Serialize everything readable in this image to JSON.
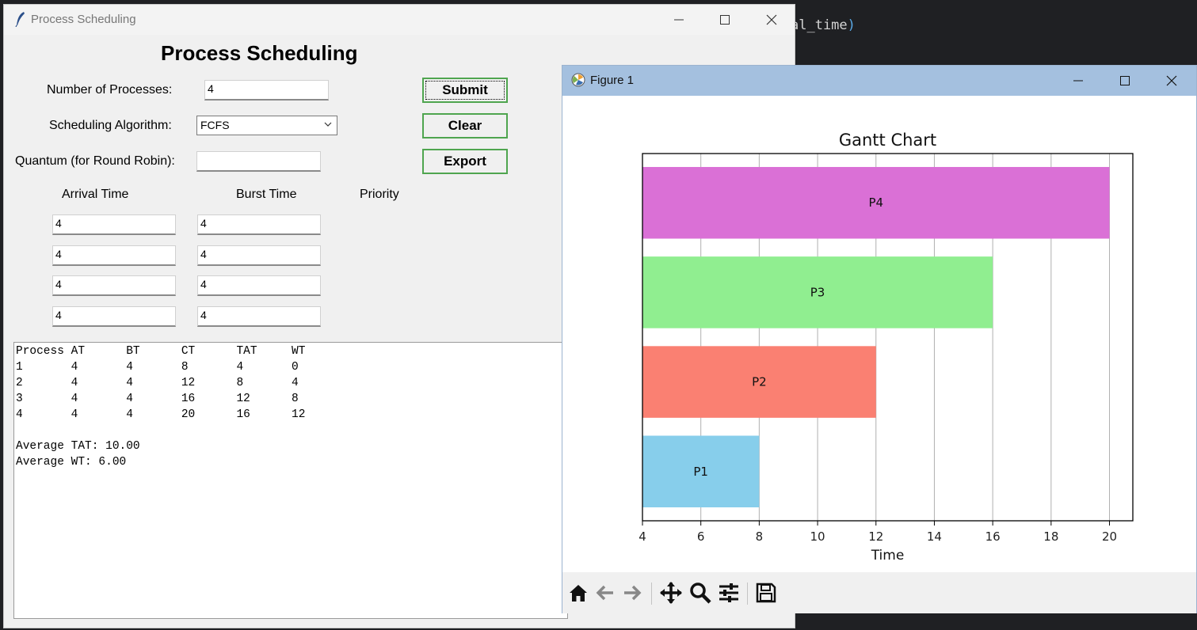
{
  "editor": {
    "code_fragment": "al_time",
    "code_paren": ")"
  },
  "tk_window": {
    "title": "Process Scheduling",
    "heading": "Process Scheduling",
    "labels": {
      "num_processes": "Number of Processes:",
      "algorithm": "Scheduling Algorithm:",
      "quantum": "Quantum (for Round Robin):",
      "arrival_time": "Arrival Time",
      "burst_time": "Burst Time",
      "priority": "Priority"
    },
    "num_processes_value": "4",
    "algorithm_value": "FCFS",
    "quantum_value": "",
    "buttons": {
      "submit": "Submit",
      "clear": "Clear",
      "export": "Export"
    },
    "process_rows": [
      {
        "arrival": "4",
        "burst": "4"
      },
      {
        "arrival": "4",
        "burst": "4"
      },
      {
        "arrival": "4",
        "burst": "4"
      },
      {
        "arrival": "4",
        "burst": "4"
      }
    ],
    "output_text": "Process AT      BT      CT      TAT     WT\n1       4       4       8       4       0\n2       4       4       12      8       4\n3       4       4       16      12      8\n4       4       4       20      16      12\n\nAverage TAT: 10.00\nAverage WT: 6.00"
  },
  "figure_window": {
    "title": "Figure 1",
    "toolbar": [
      "home-icon",
      "back-icon",
      "forward-icon",
      "pan-icon",
      "zoom-icon",
      "configure-icon",
      "save-icon"
    ]
  },
  "chart_data": {
    "type": "bar",
    "orientation": "horizontal",
    "title": "Gantt Chart",
    "xlabel": "Time",
    "ylabel": "",
    "xlim": [
      4,
      20.8
    ],
    "xticks": [
      4,
      6,
      8,
      10,
      12,
      14,
      16,
      18,
      20
    ],
    "grid": "vertical",
    "bars": [
      {
        "label": "P1",
        "start": 4,
        "end": 8,
        "color": "#87ceeb"
      },
      {
        "label": "P2",
        "start": 4,
        "end": 12,
        "color": "#fa8072"
      },
      {
        "label": "P3",
        "start": 4,
        "end": 16,
        "color": "#90ee90"
      },
      {
        "label": "P4",
        "start": 4,
        "end": 20,
        "color": "#da70d6"
      }
    ]
  }
}
